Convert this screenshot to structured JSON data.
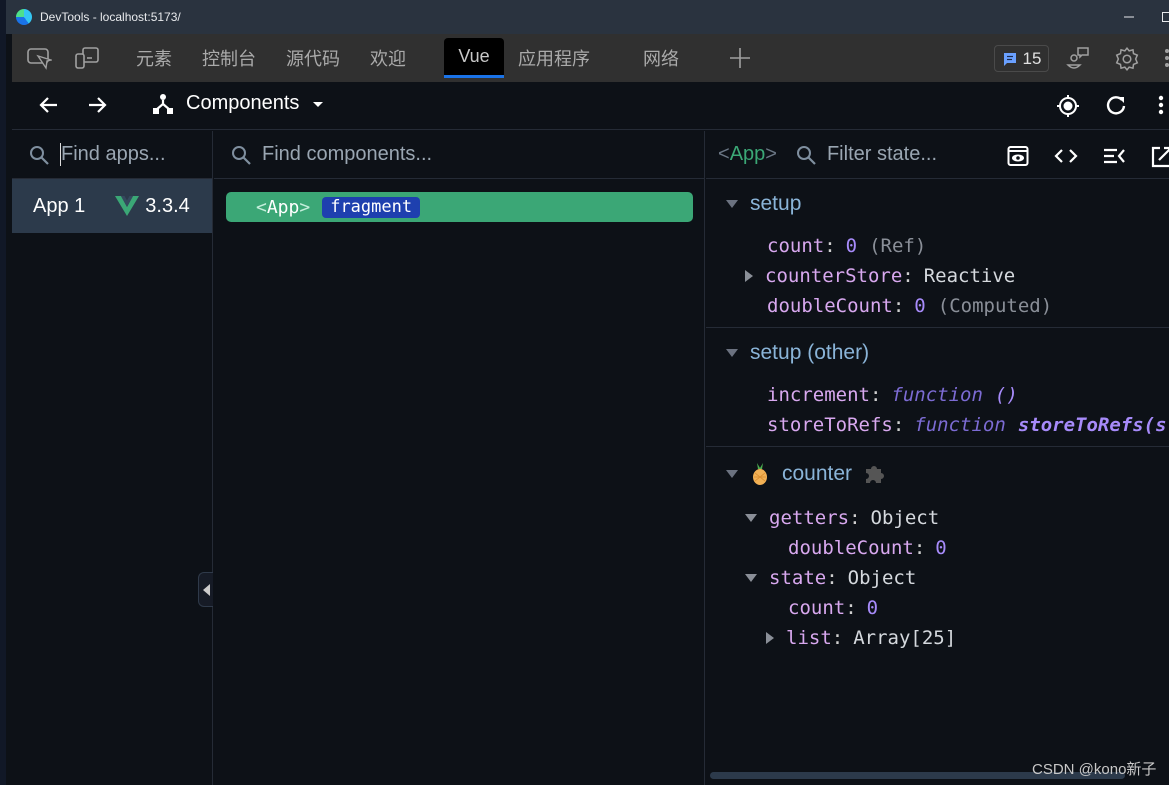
{
  "window": {
    "title": "DevTools - localhost:5173/",
    "controls": [
      "minimize",
      "maximize",
      "close"
    ]
  },
  "devtools_tabs": {
    "items": [
      {
        "label": "元素",
        "active": false
      },
      {
        "label": "控制台",
        "active": false
      },
      {
        "label": "源代码",
        "active": false
      },
      {
        "label": "欢迎",
        "active": false
      },
      {
        "label": "Vue",
        "active": true
      },
      {
        "label": "应用程序",
        "active": false
      },
      {
        "label": "网络",
        "active": false
      }
    ],
    "issues_count": "15",
    "colors": {
      "active_underline": "#1a73e8"
    }
  },
  "vue_toolbar": {
    "view_selector": "Components"
  },
  "apps_pane": {
    "search_placeholder": "Find apps...",
    "apps": [
      {
        "name": "App 1",
        "version": "3.3.4"
      }
    ]
  },
  "tree_pane": {
    "search_placeholder": "Find components...",
    "selected": {
      "open": "<",
      "name": "App",
      "close": ">",
      "badge": "fragment"
    },
    "colors": {
      "selected_bg": "#3ba776",
      "badge_bg": "#1e40af"
    }
  },
  "state_pane": {
    "component": {
      "open": "<",
      "name": "App",
      "close": ">"
    },
    "filter_placeholder": "Filter state...",
    "sections": {
      "setup": {
        "title": "setup",
        "rows": [
          {
            "key": "count",
            "value": "0",
            "note": "(Ref)"
          },
          {
            "key": "counterStore",
            "value": "Reactive"
          },
          {
            "key": "doubleCount",
            "value": "0",
            "note": "(Computed)"
          }
        ]
      },
      "setup_other": {
        "title": "setup (other)",
        "rows": [
          {
            "key": "increment",
            "fn": "function",
            "sig": "()"
          },
          {
            "key": "storeToRefs",
            "fn": "function",
            "sig": "storeToRefs(s"
          }
        ]
      },
      "counter": {
        "title": "counter",
        "getters": {
          "key": "getters",
          "value": "Object",
          "children": [
            {
              "key": "doubleCount",
              "value": "0"
            }
          ]
        },
        "state": {
          "key": "state",
          "value": "Object",
          "children": [
            {
              "key": "count",
              "value": "0"
            },
            {
              "key": "list",
              "value": "Array[25]"
            }
          ]
        }
      }
    }
  },
  "watermark": "CSDN @kono新子"
}
